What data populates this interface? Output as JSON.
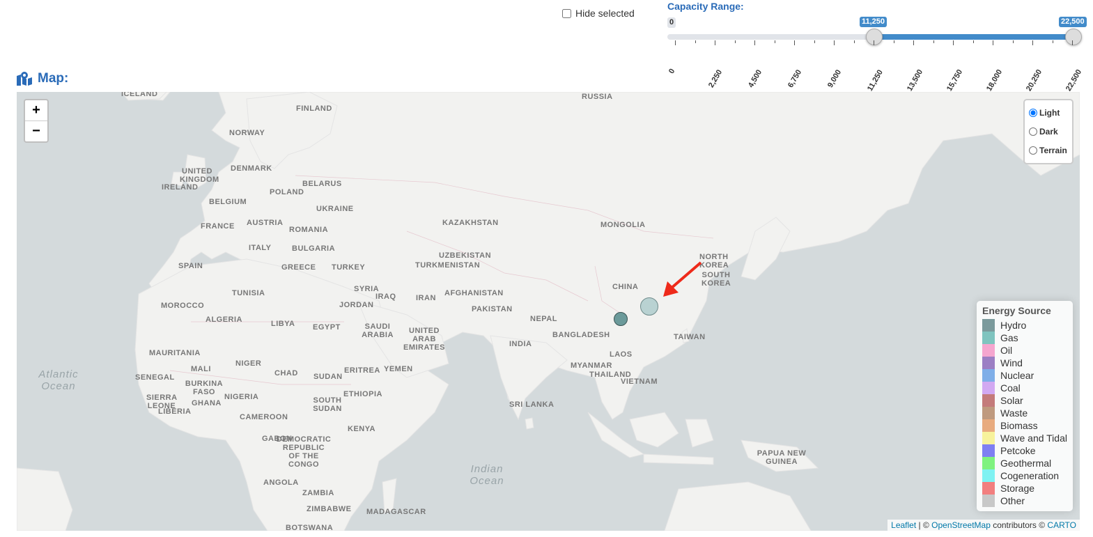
{
  "hide_selected": {
    "label": "Hide selected",
    "checked": false
  },
  "capacity_range": {
    "title": "Capacity Range:",
    "min": "0",
    "from": "11,250",
    "to": "22,500",
    "ticks": [
      "0",
      "2,250",
      "4,500",
      "6,750",
      "9,000",
      "11,250",
      "13,500",
      "15,750",
      "18,000",
      "20,250",
      "22,500"
    ]
  },
  "map": {
    "heading": "Map:",
    "zoom_in": "+",
    "zoom_out": "−",
    "layers": [
      {
        "label": "Light",
        "checked": true
      },
      {
        "label": "Dark",
        "checked": false
      },
      {
        "label": "Terrain",
        "checked": false
      }
    ],
    "country_labels": {
      "iceland": "ICELAND",
      "russia": "RUSSIA",
      "finland": "FINLAND",
      "norway": "NORWAY",
      "united_kingdom": "UNITED KINGDOM",
      "denmark": "DENMARK",
      "ireland": "IRELAND",
      "belarus": "BELARUS",
      "poland": "POLAND",
      "belgium": "BELGIUM",
      "ukraine": "UKRAINE",
      "france": "FRANCE",
      "austria": "AUSTRIA",
      "romania": "ROMANIA",
      "kazakhstan": "KAZAKHSTAN",
      "mongolia": "MONGOLIA",
      "italy": "ITALY",
      "bulgaria": "BULGARIA",
      "spain": "SPAIN",
      "greece": "GREECE",
      "turkey": "TURKEY",
      "uzbekistan": "UZBEKISTAN",
      "turkmenistan": "TURKMENISTAN",
      "north_korea": "NORTH KOREA",
      "south_korea": "SOUTH KOREA",
      "tunisia": "TUNISIA",
      "syria": "SYRIA",
      "iraq": "IRAQ",
      "iran": "IRAN",
      "afghanistan": "AFGHANISTAN",
      "china": "CHINA",
      "morocco": "MOROCCO",
      "jordan": "JORDAN",
      "pakistan": "PAKISTAN",
      "algeria": "ALGERIA",
      "libya": "LIBYA",
      "egypt": "EGYPT",
      "nepal": "NEPAL",
      "saudi_arabia": "SAUDI ARABIA",
      "united_arab_emirates": "UNITED ARAB EMIRATES",
      "bangladesh": "BANGLADESH",
      "taiwan": "TAIWAN",
      "india": "INDIA",
      "mauritania": "MAURITANIA",
      "laos": "LAOS",
      "mali": "MALI",
      "niger": "NIGER",
      "eritrea": "ERITREA",
      "yemen": "YEMEN",
      "myanmar": "MYANMAR",
      "chad": "CHAD",
      "senegal": "SENEGAL",
      "sudan": "SUDAN",
      "thailand": "THAILAND",
      "vietnam": "VIETNAM",
      "burkina_faso": "BURKINA FASO",
      "ethiopia": "ETHIOPIA",
      "nigeria": "NIGERIA",
      "sierra_leone": "SIERRA LEONE",
      "ghana": "GHANA",
      "liberia": "LIBERIA",
      "south_sudan": "SOUTH SUDAN",
      "sri_lanka": "SRI LANKA",
      "cameroon": "CAMEROON",
      "kenya": "KENYA",
      "gabon": "GABON",
      "drc": "DEMOCRATIC REPUBLIC OF THE CONGO",
      "papua_new_guinea": "PAPUA NEW GUINEA",
      "angola": "ANGOLA",
      "zambia": "ZAMBIA",
      "zimbabwe": "ZIMBABWE",
      "madagascar": "MADAGASCAR",
      "botswana": "BOTSWANA"
    },
    "ocean_labels": {
      "atlantic": "Atlantic Ocean",
      "indian": "Indian Ocean"
    },
    "legend": {
      "title": "Energy Source",
      "items": [
        {
          "label": "Hydro",
          "color": "#7b9a9c"
        },
        {
          "label": "Gas",
          "color": "#7fc4bf"
        },
        {
          "label": "Oil",
          "color": "#f5a6cf"
        },
        {
          "label": "Wind",
          "color": "#9c7fc4"
        },
        {
          "label": "Nuclear",
          "color": "#7faee8"
        },
        {
          "label": "Coal",
          "color": "#d2a9f2"
        },
        {
          "label": "Solar",
          "color": "#c47b7b"
        },
        {
          "label": "Waste",
          "color": "#bf9a7f"
        },
        {
          "label": "Biomass",
          "color": "#e8ab7f"
        },
        {
          "label": "Wave and Tidal",
          "color": "#f7f29c"
        },
        {
          "label": "Petcoke",
          "color": "#7f7ff2"
        },
        {
          "label": "Geothermal",
          "color": "#7ff27f"
        },
        {
          "label": "Cogeneration",
          "color": "#7ff2f2"
        },
        {
          "label": "Storage",
          "color": "#f27f7f"
        },
        {
          "label": "Other",
          "color": "#c8c8c8"
        }
      ]
    },
    "attribution": {
      "leaflet": "Leaflet",
      "sep": " | © ",
      "osm": "OpenStreetMap",
      "mid": " contributors © ",
      "carto": "CARTO"
    }
  }
}
